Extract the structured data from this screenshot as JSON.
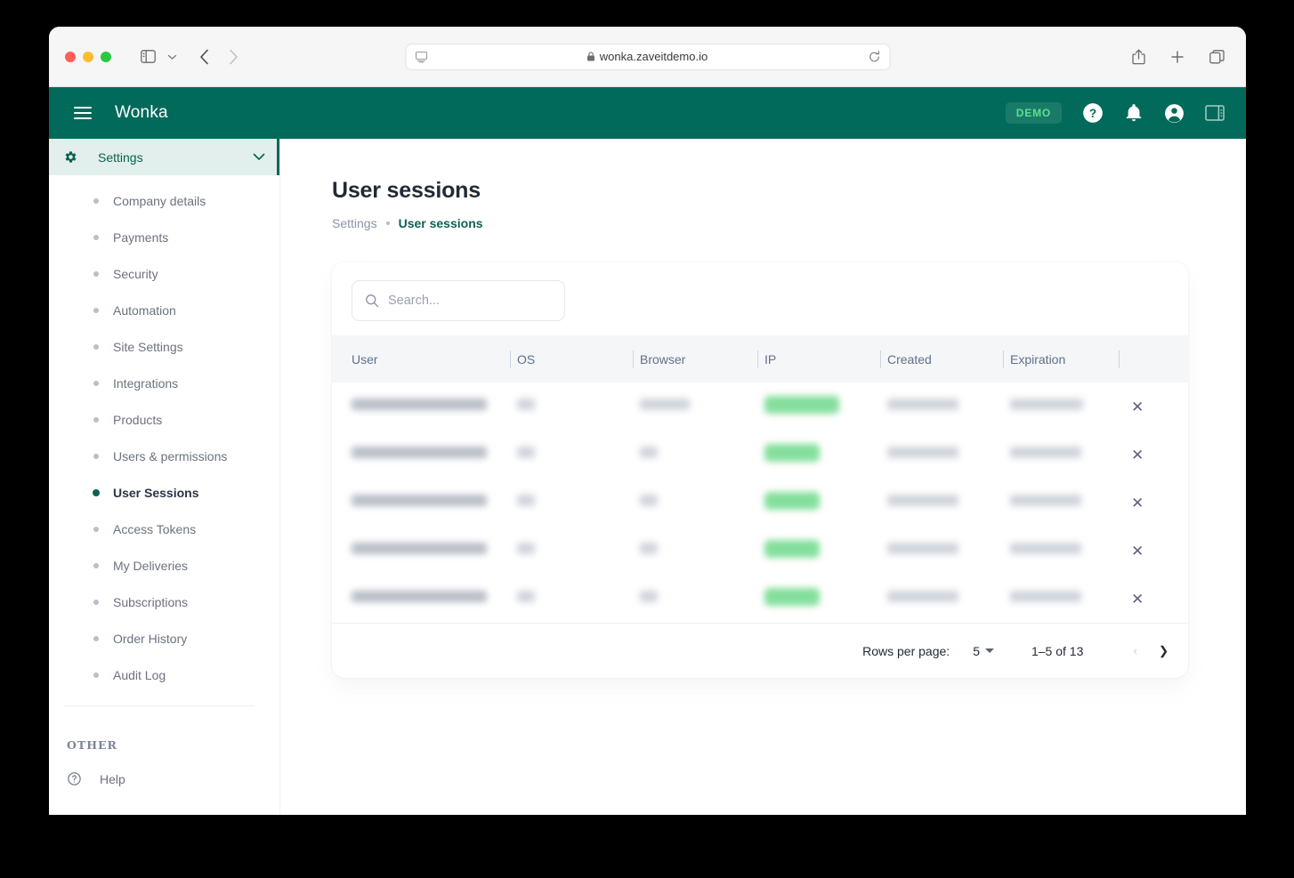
{
  "browser": {
    "url": "wonka.zaveitdemo.io",
    "lock_icon": "lock-icon",
    "reader_icon": "reader-view-icon",
    "reload_icon": "reload-icon",
    "sidebar_toggle_icon": "sidebar-toggle-icon",
    "tab_group_chevron_icon": "chevron-down-icon",
    "back_icon": "back-arrow-icon",
    "forward_icon": "forward-arrow-icon",
    "share_icon": "share-icon",
    "new_tab_icon": "plus-icon",
    "tab_overview_icon": "tab-overview-icon"
  },
  "appbar": {
    "menu_icon": "hamburger-menu-icon",
    "brand": "Wonka",
    "badge": "DEMO",
    "help_icon": "help-circle-icon",
    "notifications_icon": "bell-icon",
    "account_icon": "account-circle-icon",
    "panel_icon": "right-panel-toggle-icon"
  },
  "sidebar": {
    "section": {
      "label": "Settings",
      "gear_icon": "gear-icon",
      "chevron_icon": "chevron-down-icon"
    },
    "items": [
      {
        "label": "Company details",
        "active": false
      },
      {
        "label": "Payments",
        "active": false
      },
      {
        "label": "Security",
        "active": false
      },
      {
        "label": "Automation",
        "active": false
      },
      {
        "label": "Site Settings",
        "active": false
      },
      {
        "label": "Integrations",
        "active": false
      },
      {
        "label": "Products",
        "active": false
      },
      {
        "label": "Users & permissions",
        "active": false
      },
      {
        "label": "User Sessions",
        "active": true
      },
      {
        "label": "Access Tokens",
        "active": false
      },
      {
        "label": "My Deliveries",
        "active": false
      },
      {
        "label": "Subscriptions",
        "active": false
      },
      {
        "label": "Order History",
        "active": false
      },
      {
        "label": "Audit Log",
        "active": false
      }
    ],
    "other_label": "OTHER",
    "help": {
      "label": "Help",
      "icon": "help-circle-outline-icon"
    }
  },
  "main": {
    "title": "User sessions",
    "breadcrumb": {
      "parent": "Settings",
      "current": "User sessions"
    },
    "search": {
      "placeholder": "Search...",
      "value": "",
      "icon": "search-icon"
    },
    "table": {
      "columns": [
        "User",
        "OS",
        "Browser",
        "IP",
        "Created",
        "Expiration",
        ""
      ],
      "rows": [
        {
          "user": "",
          "os": "",
          "browser": "",
          "ip": "",
          "created": "",
          "expiration": "",
          "action_icon": "close-icon",
          "redacted": true
        },
        {
          "user": "",
          "os": "",
          "browser": "",
          "ip": "",
          "created": "",
          "expiration": "",
          "action_icon": "close-icon",
          "redacted": true
        },
        {
          "user": "",
          "os": "",
          "browser": "",
          "ip": "",
          "created": "",
          "expiration": "",
          "action_icon": "close-icon",
          "redacted": true
        },
        {
          "user": "",
          "os": "",
          "browser": "",
          "ip": "",
          "created": "",
          "expiration": "",
          "action_icon": "close-icon",
          "redacted": true
        },
        {
          "user": "",
          "os": "",
          "browser": "",
          "ip": "",
          "created": "",
          "expiration": "",
          "action_icon": "close-icon",
          "redacted": true
        }
      ],
      "row_action_label": "✕"
    },
    "pagination": {
      "rows_per_page_label": "Rows per page:",
      "rows_per_page_value": "5",
      "range": "1–5 of 13",
      "prev_icon": "chevron-left-icon",
      "next_icon": "chevron-right-icon",
      "prev_label": "‹",
      "next_label": "❯"
    }
  },
  "colors": {
    "brand_green": "#026a5a",
    "accent_green": "#0b6253",
    "badge_text": "#5ce08f",
    "chip_green": "#6fd98c",
    "header_row": "#f4f6f8",
    "text_dark": "#212b36",
    "text_muted": "#6b7280"
  }
}
